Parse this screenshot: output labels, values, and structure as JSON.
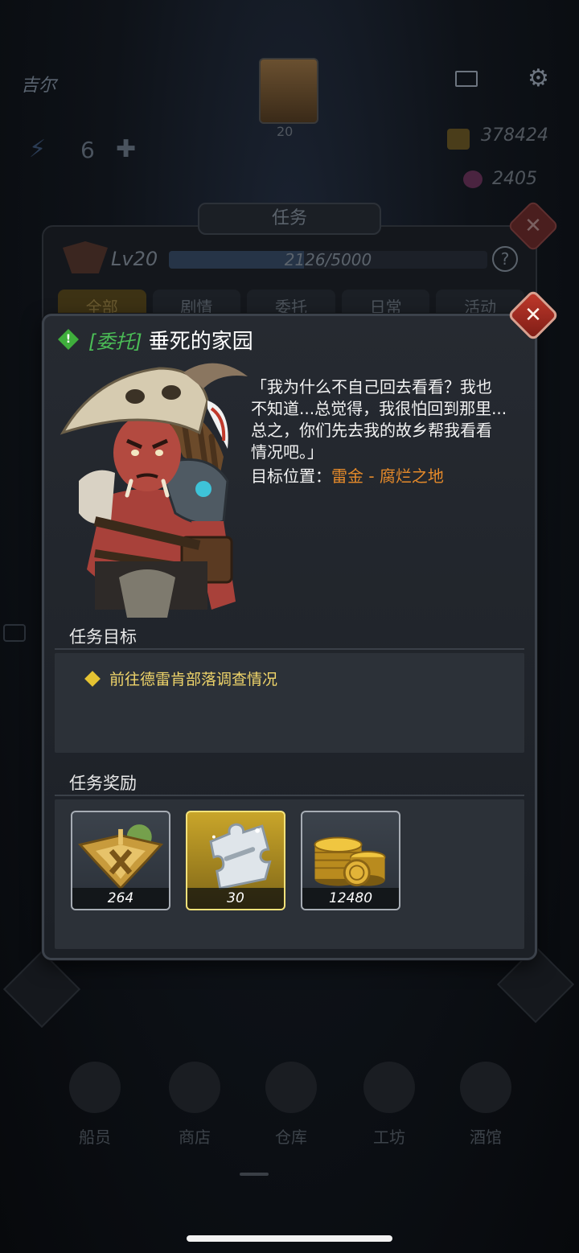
{
  "background": {
    "player_name": "吉尔",
    "player_level": "20",
    "energy": "6",
    "gold": "378424",
    "gems": "2405",
    "quest_panel_title": "任务",
    "level_label": "Lv20",
    "xp_text": "2126/5000",
    "xp_progress": 0.4252,
    "help_label": "?",
    "tabs": [
      "全部",
      "剧情",
      "委托",
      "日常",
      "活动"
    ],
    "nav": [
      "船员",
      "商店",
      "仓库",
      "工坊",
      "酒馆"
    ]
  },
  "quest": {
    "alert_glyph": "!",
    "tag": "[委托]",
    "name": "垂死的家园",
    "description": "「我为什么不自己回去看看？我也\n不知道...总觉得，我很怕回到那里...\n总之，你们先去我的故乡帮我看看\n情况吧。」",
    "target_label": "目标位置：",
    "target_value": "雷金 - 腐烂之地",
    "objectives_heading": "任务目标",
    "objective": "前往德雷肯部落调查情况",
    "rewards_heading": "任务奖励",
    "rewards": [
      {
        "icon": "xp-emblem-icon",
        "qty": "264"
      },
      {
        "icon": "puzzle-piece-icon",
        "qty": "30"
      },
      {
        "icon": "gold-coins-icon",
        "qty": "12480"
      }
    ]
  },
  "colors": {
    "tag_green": "#4bbd56",
    "target_orange": "#e58a2a",
    "objective_yellow": "#f0d56a",
    "close_red": "#c0392b"
  }
}
